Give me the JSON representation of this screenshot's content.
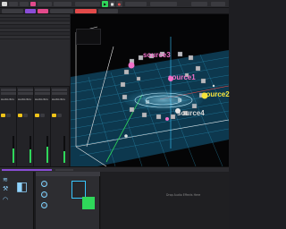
{
  "colors": {
    "accent_pink": "#e24a8b",
    "accent_orange": "#ff8c3a",
    "accent_green": "#2fd75a",
    "accent_cyan": "#38c6ff",
    "source_pink": "#f070c8",
    "source_yellow": "#f6e23a",
    "grid": "#2a8fb5"
  },
  "topbar": {
    "play_icon": "play-icon",
    "stop_icon": "stop-icon",
    "record_icon": "record-icon"
  },
  "view": {
    "info_lines": [
      "",
      "",
      "",
      ""
    ],
    "sources": [
      {
        "label": "source3",
        "color": "#f070c8"
      },
      {
        "label": "source1",
        "color": "#f070c8"
      },
      {
        "label": "source2",
        "color": "#f6e23a"
      },
      {
        "label": "source4",
        "color": "#d8d8d8"
      }
    ]
  },
  "mixer": {
    "strips": [
      {
        "name": "Audio Rcv",
        "level": 0.55
      },
      {
        "name": "Audio Rcv",
        "level": 0.5
      },
      {
        "name": "Audio Rcv",
        "level": 0.6
      },
      {
        "name": "Audio Rcv",
        "level": 0.45
      }
    ]
  },
  "device": {
    "panel_title": "",
    "params": [
      "",
      "",
      ""
    ],
    "drop_text": "Drop Audio Effects Here"
  }
}
